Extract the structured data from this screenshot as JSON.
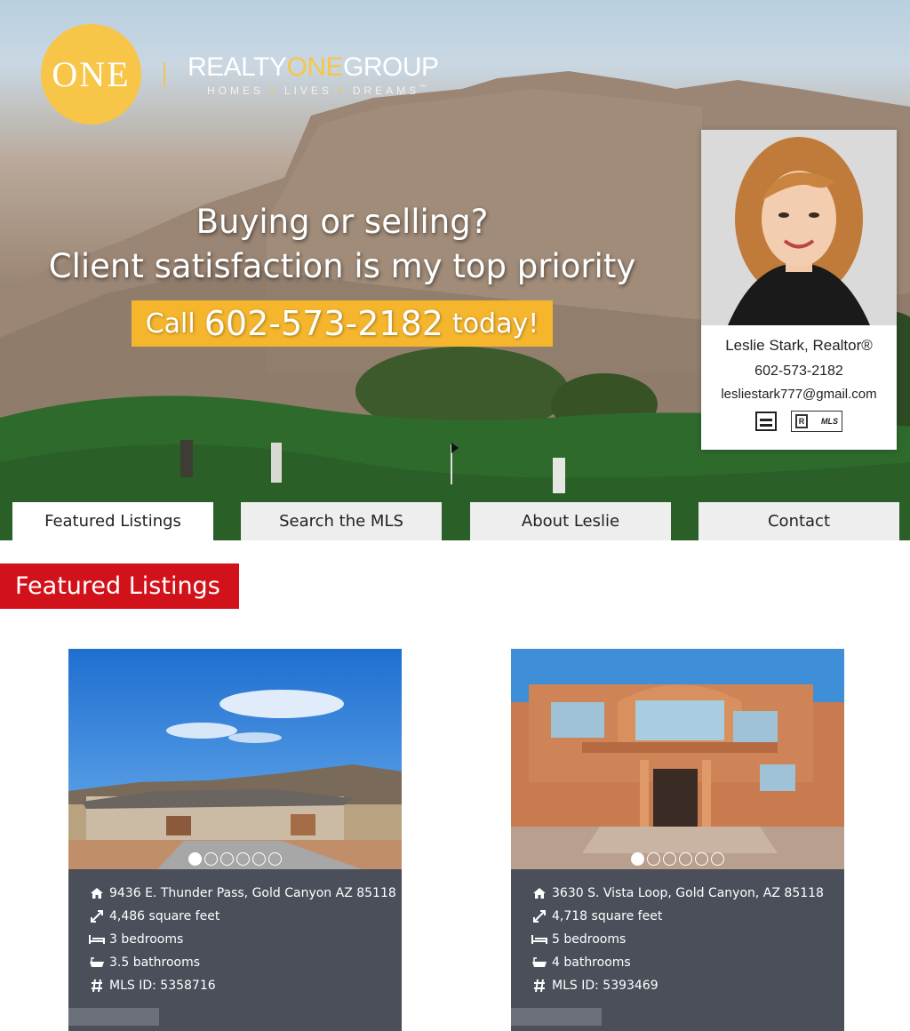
{
  "brand": {
    "circle_text": "ONE",
    "name_part1": "REALTY",
    "name_part2": "ONE",
    "name_part3": "GROUP",
    "tag_homes": "HOMES",
    "tag_lives": "LIVES",
    "tag_dreams": "DREAMS",
    "tag_sep": "•",
    "tm": "™"
  },
  "hero": {
    "line1": "Buying or selling?",
    "line2": "Client satisfaction is my top priority",
    "cta_call": "Call",
    "cta_phone": "602-573-2182",
    "cta_today": "today!"
  },
  "agent": {
    "name": "Leslie Stark, Realtor®",
    "phone": "602-573-2182",
    "email": "lesliestark777@gmail.com",
    "badge_mls": "MLS",
    "badge_r": "R"
  },
  "tabs": [
    {
      "label": "Featured Listings"
    },
    {
      "label": "Search the MLS"
    },
    {
      "label": "About Leslie"
    },
    {
      "label": "Contact"
    }
  ],
  "section": {
    "title": "Featured Listings"
  },
  "listings": [
    {
      "address": "9436 E. Thunder Pass, Gold Canyon AZ 85118",
      "sqft": "4,486 square feet",
      "bedrooms": "3 bedrooms",
      "bathrooms": "3.5 bathrooms",
      "mls": "MLS ID: 5358716"
    },
    {
      "address": "3630 S. Vista Loop, Gold Canyon, AZ 85118",
      "sqft": "4,718 square feet",
      "bedrooms": "5 bedrooms",
      "bathrooms": "4 bathrooms",
      "mls": "MLS ID: 5393469"
    }
  ],
  "colors": {
    "brand_yellow": "#f7c548",
    "cta_yellow": "#f5b62d",
    "section_red": "#d2121a",
    "card_bg": "#4a4f59"
  },
  "icons": [
    "home-icon",
    "resize-icon",
    "bed-icon",
    "bath-icon",
    "hash-icon"
  ]
}
